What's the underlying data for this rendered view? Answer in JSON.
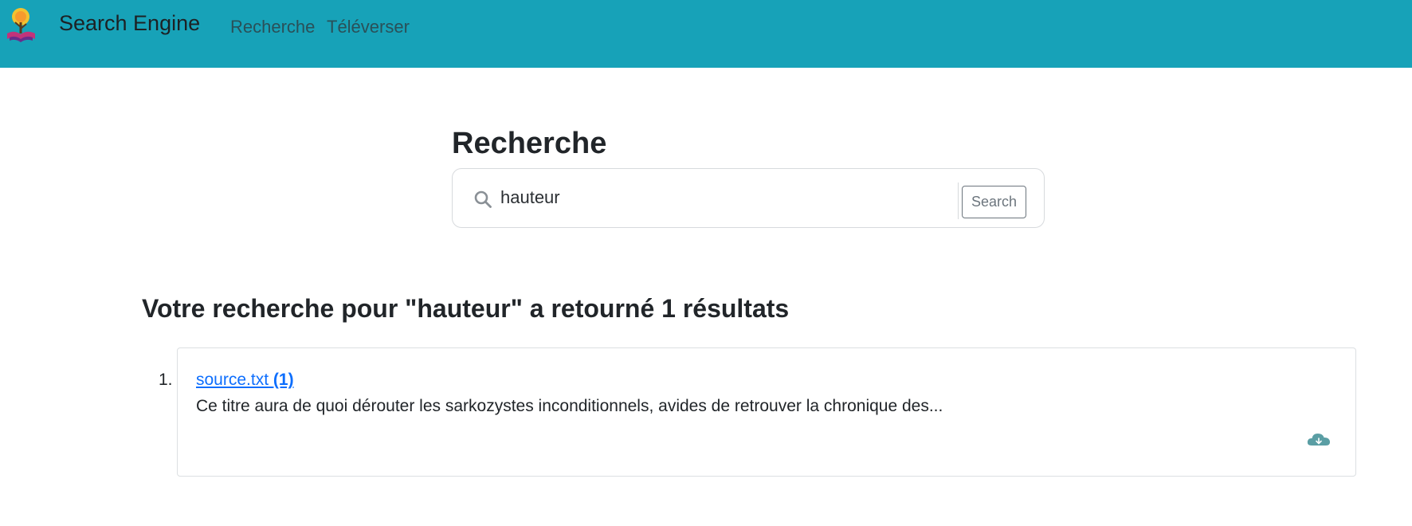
{
  "navbar": {
    "brand": "Search Engine",
    "links": [
      {
        "label": "Recherche"
      },
      {
        "label": "Téléverser"
      }
    ],
    "background_color": "#17a2b8"
  },
  "search": {
    "title": "Recherche",
    "query": "hauteur",
    "button_label": "Search",
    "icon": "search-icon"
  },
  "results": {
    "heading": "Votre recherche pour \"hauteur\" a retourné 1 résultats",
    "items": [
      {
        "number": "1.",
        "filename": "source.txt",
        "count": "(1)",
        "snippet": "Ce titre aura de quoi dérouter les sarkozystes inconditionnels, avides de retrouver la chronique des...",
        "action_icon": "cloud-download-icon"
      }
    ]
  },
  "colors": {
    "accent": "#17a2b8",
    "link": "#0d6efd",
    "cloud_icon": "#5a9ea4"
  }
}
